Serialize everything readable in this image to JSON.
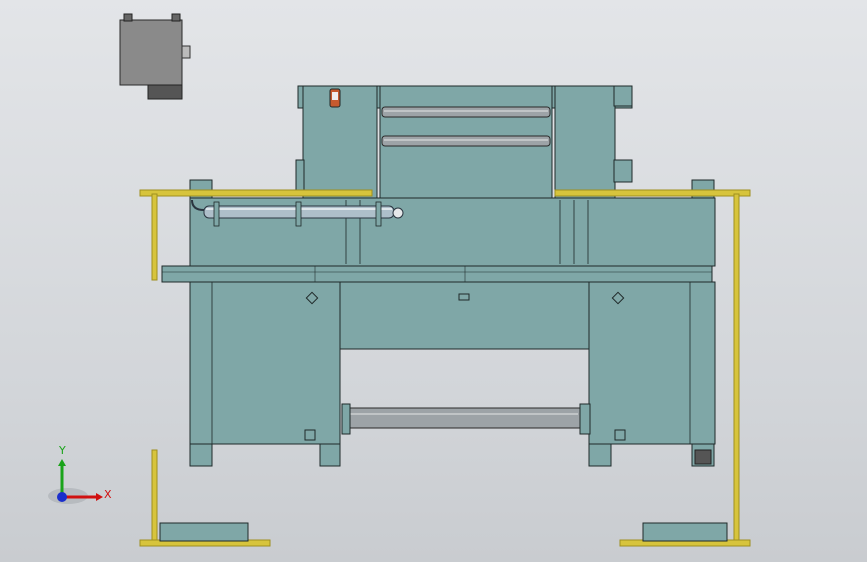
{
  "colors": {
    "body": "#7fa7a7",
    "body_dark": "#6b9494",
    "outline": "#1f2a2a",
    "rail": "#d7c43c",
    "rail_dark": "#9f8f1e",
    "steel": "#9da3a7",
    "motor": "#8e8e8e",
    "axis_x": "#d01010",
    "axis_y": "#1aa31a",
    "axis_z": "#1a2ecc"
  },
  "triad": {
    "x_label": "X",
    "y_label": "Y"
  },
  "model_parts": [
    "motor-box",
    "upper-housing",
    "roller-upper",
    "roller-lower",
    "main-frame",
    "cylinder-pipe",
    "crossbar",
    "lower-shaft",
    "safety-rail-left",
    "safety-rail-right",
    "bottom-base-left",
    "bottom-base-right"
  ]
}
